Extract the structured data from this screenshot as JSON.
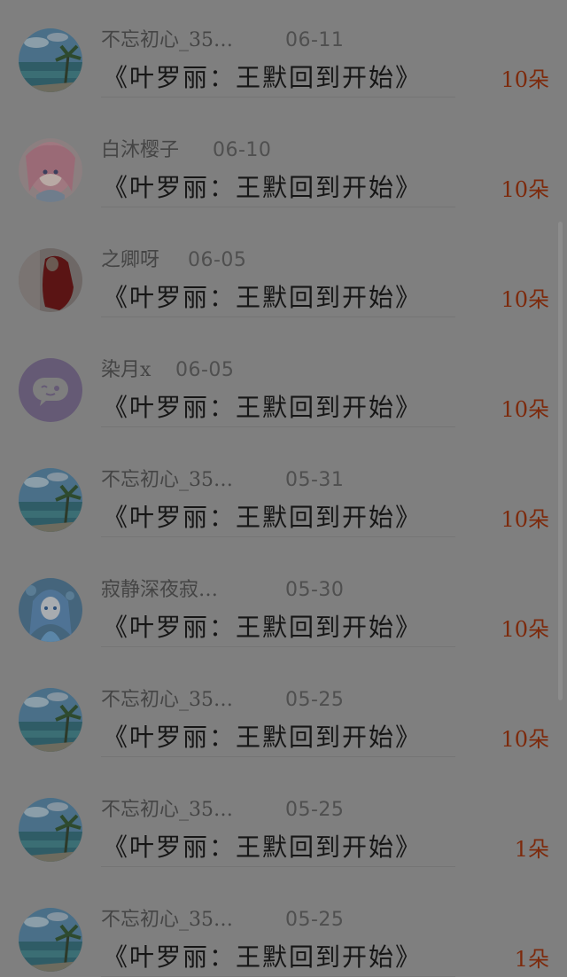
{
  "gift_list": {
    "items": [
      {
        "name": "不忘初心_35…",
        "date": "06-11",
        "title": "《叶罗丽：王默回到开始》",
        "count": "10朵",
        "avatar": "beach-avatar"
      },
      {
        "name": "白沐樱子",
        "date": "06-10",
        "title": "《叶罗丽：王默回到开始》",
        "count": "10朵",
        "avatar": "anime-pink-hair-avatar"
      },
      {
        "name": "之卿呀",
        "date": "06-05",
        "title": "《叶罗丽：王默回到开始》",
        "count": "10朵",
        "avatar": "red-dress-avatar"
      },
      {
        "name": "染月x",
        "date": "06-05",
        "title": "《叶罗丽：王默回到开始》",
        "count": "10朵",
        "avatar": "default-chat-avatar"
      },
      {
        "name": "不忘初心_35…",
        "date": "05-31",
        "title": "《叶罗丽：王默回到开始》",
        "count": "10朵",
        "avatar": "beach-avatar"
      },
      {
        "name": "寂静深夜寂…",
        "date": "05-30",
        "title": "《叶罗丽：王默回到开始》",
        "count": "10朵",
        "avatar": "anime-blue-hair-avatar"
      },
      {
        "name": "不忘初心_35…",
        "date": "05-25",
        "title": "《叶罗丽：王默回到开始》",
        "count": "10朵",
        "avatar": "beach-avatar"
      },
      {
        "name": "不忘初心_35…",
        "date": "05-25",
        "title": "《叶罗丽：王默回到开始》",
        "count": "1朵",
        "avatar": "beach-avatar"
      },
      {
        "name": "不忘初心_35…",
        "date": "05-25",
        "title": "《叶罗丽：王默回到开始》",
        "count": "1朵",
        "avatar": "beach-avatar"
      }
    ]
  }
}
